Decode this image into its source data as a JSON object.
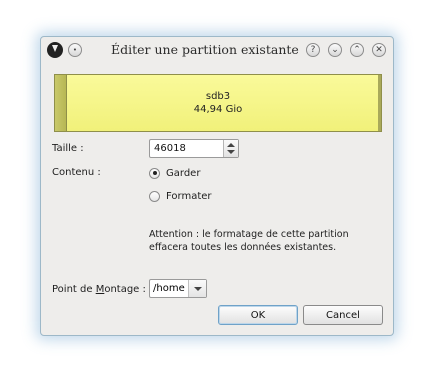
{
  "window": {
    "title": "Éditer une partition existante",
    "controls": {
      "help": "?",
      "minimize": "⌄",
      "maximize": "⌃",
      "close": "✕"
    }
  },
  "partition": {
    "name": "sdb3",
    "size": "44,94 Gio",
    "color": "#f5f58a"
  },
  "form": {
    "size_label": "Taille :",
    "size_value": "46018",
    "content_label": "Contenu :",
    "options": [
      {
        "label": "Garder",
        "checked": true
      },
      {
        "label": "Formater",
        "checked": false
      }
    ],
    "warning_line1": "Attention : le formatage de cette partition",
    "warning_line2": "effacera toutes les données existantes.",
    "mount_label_pre": "Point de ",
    "mount_label_u": "M",
    "mount_label_post": "ontage :",
    "mount_value": "/home"
  },
  "buttons": {
    "ok": "OK",
    "cancel": "Cancel"
  }
}
